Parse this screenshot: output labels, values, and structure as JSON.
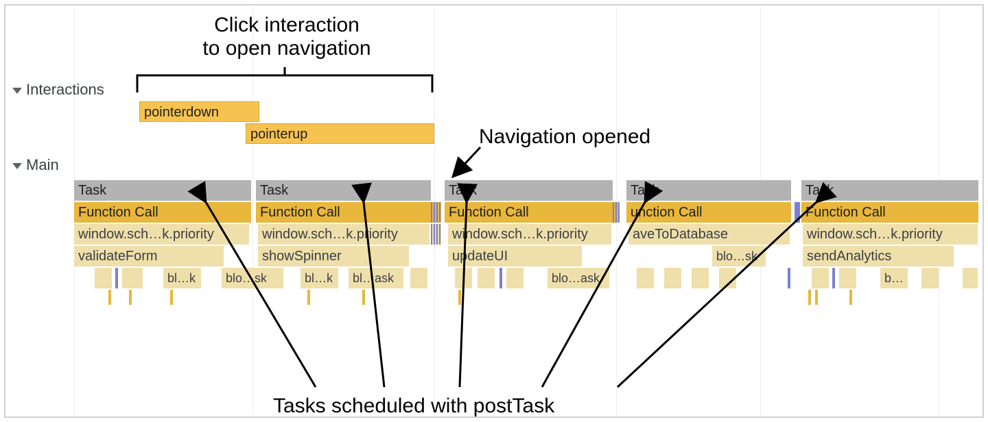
{
  "annotations": {
    "top_line1": "Click interaction",
    "top_line2": "to open navigation",
    "right": "Navigation opened",
    "bottom": "Tasks scheduled with postTask"
  },
  "tracks": {
    "interactions": "Interactions",
    "main": "Main"
  },
  "interactions": {
    "pointerdown": "pointerdown",
    "pointerup": "pointerup"
  },
  "main_row1": {
    "task": "Task",
    "fcall": "Function Call",
    "sched": "window.sch…k.priority",
    "user": "validateForm",
    "blk1": "bl…k",
    "blk2": "blo…sk"
  },
  "main_row2": {
    "task": "Task",
    "fcall": "Function Call",
    "sched": "window.sch…k.priority",
    "user": "showSpinner",
    "blk1": "bl…k",
    "blk2": "bl…ask"
  },
  "main_row3": {
    "task": "Task",
    "fcall": "Function Call",
    "sched": "window.sch…k.priority",
    "user": "updateUI",
    "blk1": "blo…ask"
  },
  "main_row4": {
    "task": "Task",
    "fcall": "unction Call",
    "sched": "aveToDatabase",
    "blk1": "blo…sk"
  },
  "main_row5": {
    "task": "Task",
    "fcall": "Function Call",
    "sched": "window.sch…k.priority",
    "user": "sendAnalytics",
    "blk1": "b…"
  }
}
